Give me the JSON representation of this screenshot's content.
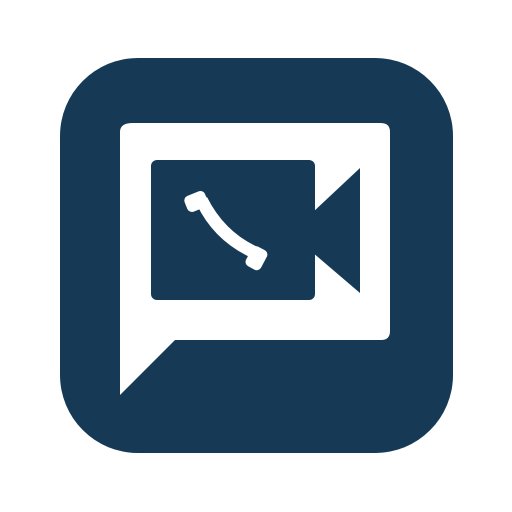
{
  "icon": {
    "name": "video-call-chat-app-icon",
    "glyphs": [
      "chat-bubble-icon",
      "video-camera-icon",
      "phone-handset-icon"
    ],
    "colors": {
      "page_background": "#ffffff",
      "tile": "#163a55",
      "glyph_light": "#ffffff"
    }
  }
}
